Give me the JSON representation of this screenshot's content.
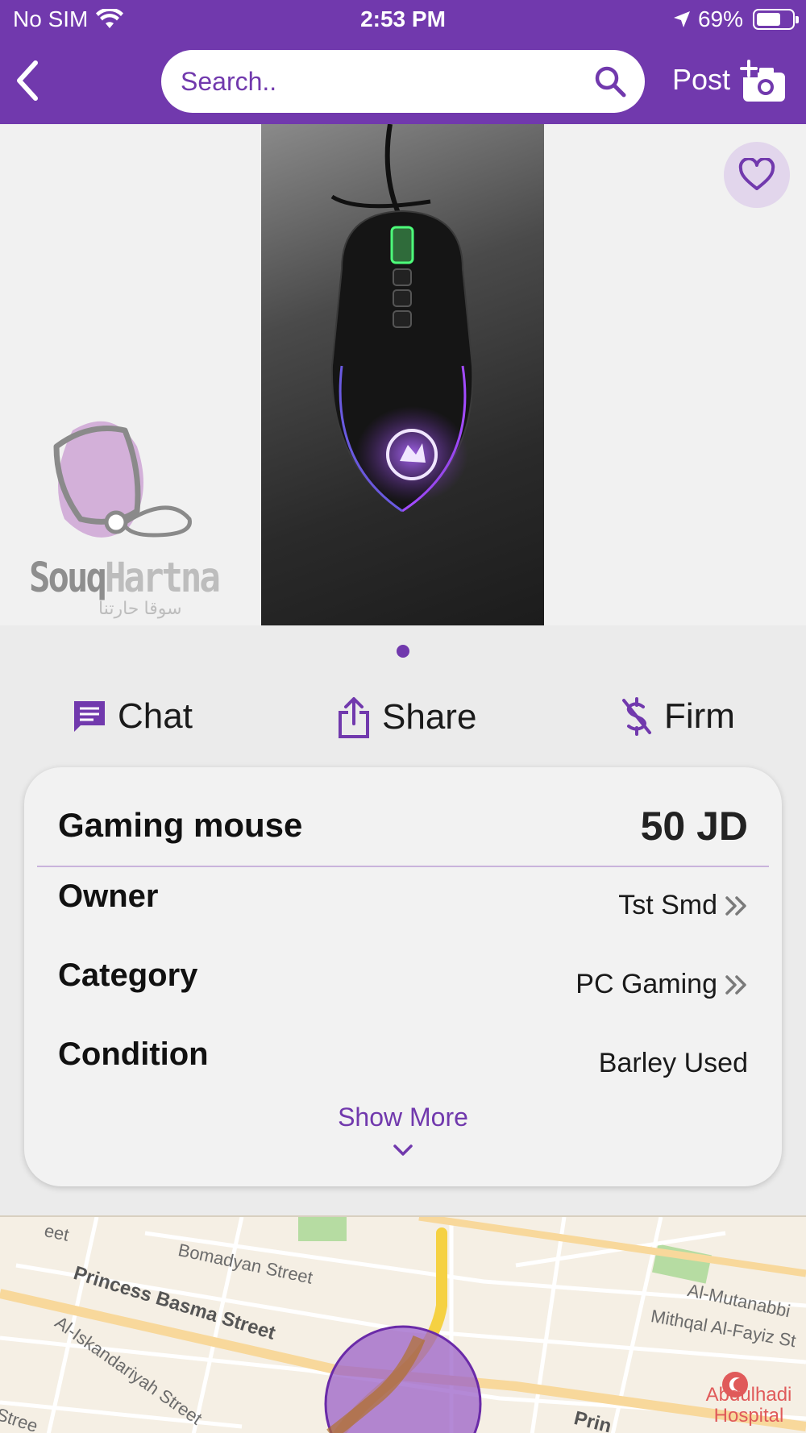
{
  "status_bar": {
    "carrier": "No SIM",
    "time": "2:53 PM",
    "battery": "69%",
    "battery_level": 0.69
  },
  "header": {
    "search_placeholder": "Search..",
    "post_label": "Post"
  },
  "gallery": {
    "page_count": 1,
    "current_page": 1,
    "logo_text_dark": "Souq",
    "logo_text_light": "Hartna",
    "logo_arabic": "سوقا حارتنا"
  },
  "actions": {
    "chat": "Chat",
    "share": "Share",
    "firm": "Firm"
  },
  "listing": {
    "title": "Gaming mouse",
    "price": "50 JD",
    "rows": [
      {
        "label": "Owner",
        "value": "Tst Smd"
      },
      {
        "label": "Category",
        "value": "PC Gaming"
      },
      {
        "label": "Condition",
        "value": "Barley Used"
      }
    ],
    "show_more": "Show More"
  },
  "map": {
    "labels": [
      "eet",
      "Bomadyan Street",
      "Princess Basma Street",
      "Al-Iskandariyah Street",
      "Al-Mutanabbi",
      "Mithqal Al-Fayiz St",
      "Stree",
      "Prin"
    ],
    "hospital": "Abdulhadi Hospital"
  },
  "colors": {
    "brand": "#7139ad",
    "background": "#ebebeb",
    "card": "#f2f2f2"
  }
}
